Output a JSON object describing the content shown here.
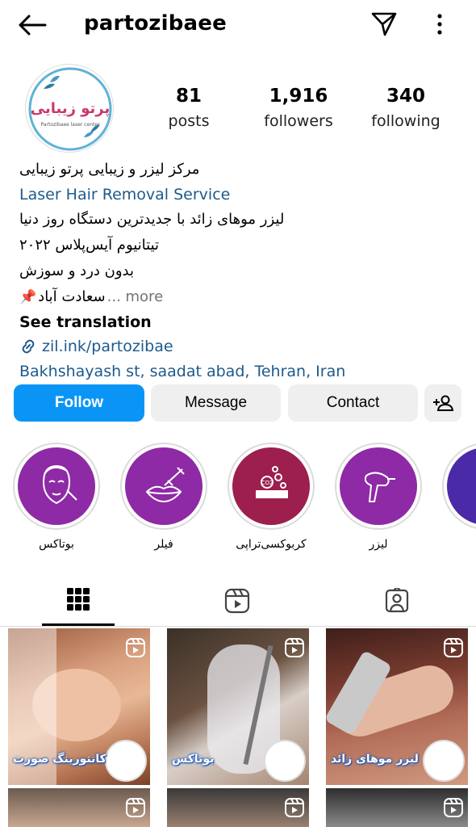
{
  "header": {
    "username": "partozibaee"
  },
  "profile": {
    "avatar_text": "پرتو زیبایی",
    "avatar_subtext": "Partozibaee laser center",
    "stats": [
      {
        "value": "81",
        "label": "posts"
      },
      {
        "value": "1,916",
        "label": "followers"
      },
      {
        "value": "340",
        "label": "following"
      }
    ]
  },
  "bio": {
    "line1": "مرکز لیزر و زیبایی پرتو زیبایی",
    "category": "Laser Hair Removal Service",
    "line2": "لیزر موهای زائد با جدیدترین دستگاه روز دنیا",
    "line3": "تیتانیوم آیس‌پلاس ۲۰۲۲",
    "line4": "بدون درد و سوزش",
    "line5": "سعادت آباد",
    "more": "... more",
    "see_translation": "See translation",
    "link": "zil.ink/partozibae",
    "address": "Bakhshayash st, saadat abad, Tehran, Iran"
  },
  "actions": {
    "follow": "Follow",
    "message": "Message",
    "contact": "Contact"
  },
  "highlights": [
    {
      "label": "بوتاکس",
      "color": "#8e2aa6"
    },
    {
      "label": "فیلر",
      "color": "#8e2aa6"
    },
    {
      "label": "کربوکسی‌تراپی",
      "color": "#9c1f4e"
    },
    {
      "label": "لیزر",
      "color": "#8e2aa6"
    },
    {
      "label": "",
      "color": "#4a2aa6"
    }
  ],
  "posts": [
    {
      "caption": "کانتورینگ صورت"
    },
    {
      "caption": "بوتاکس"
    },
    {
      "caption": "لیزر موهای زائد"
    }
  ],
  "colors": {
    "follow_blue": "#0a95f6",
    "link_blue": "#1d5a8c",
    "button_gray": "#efefef"
  }
}
